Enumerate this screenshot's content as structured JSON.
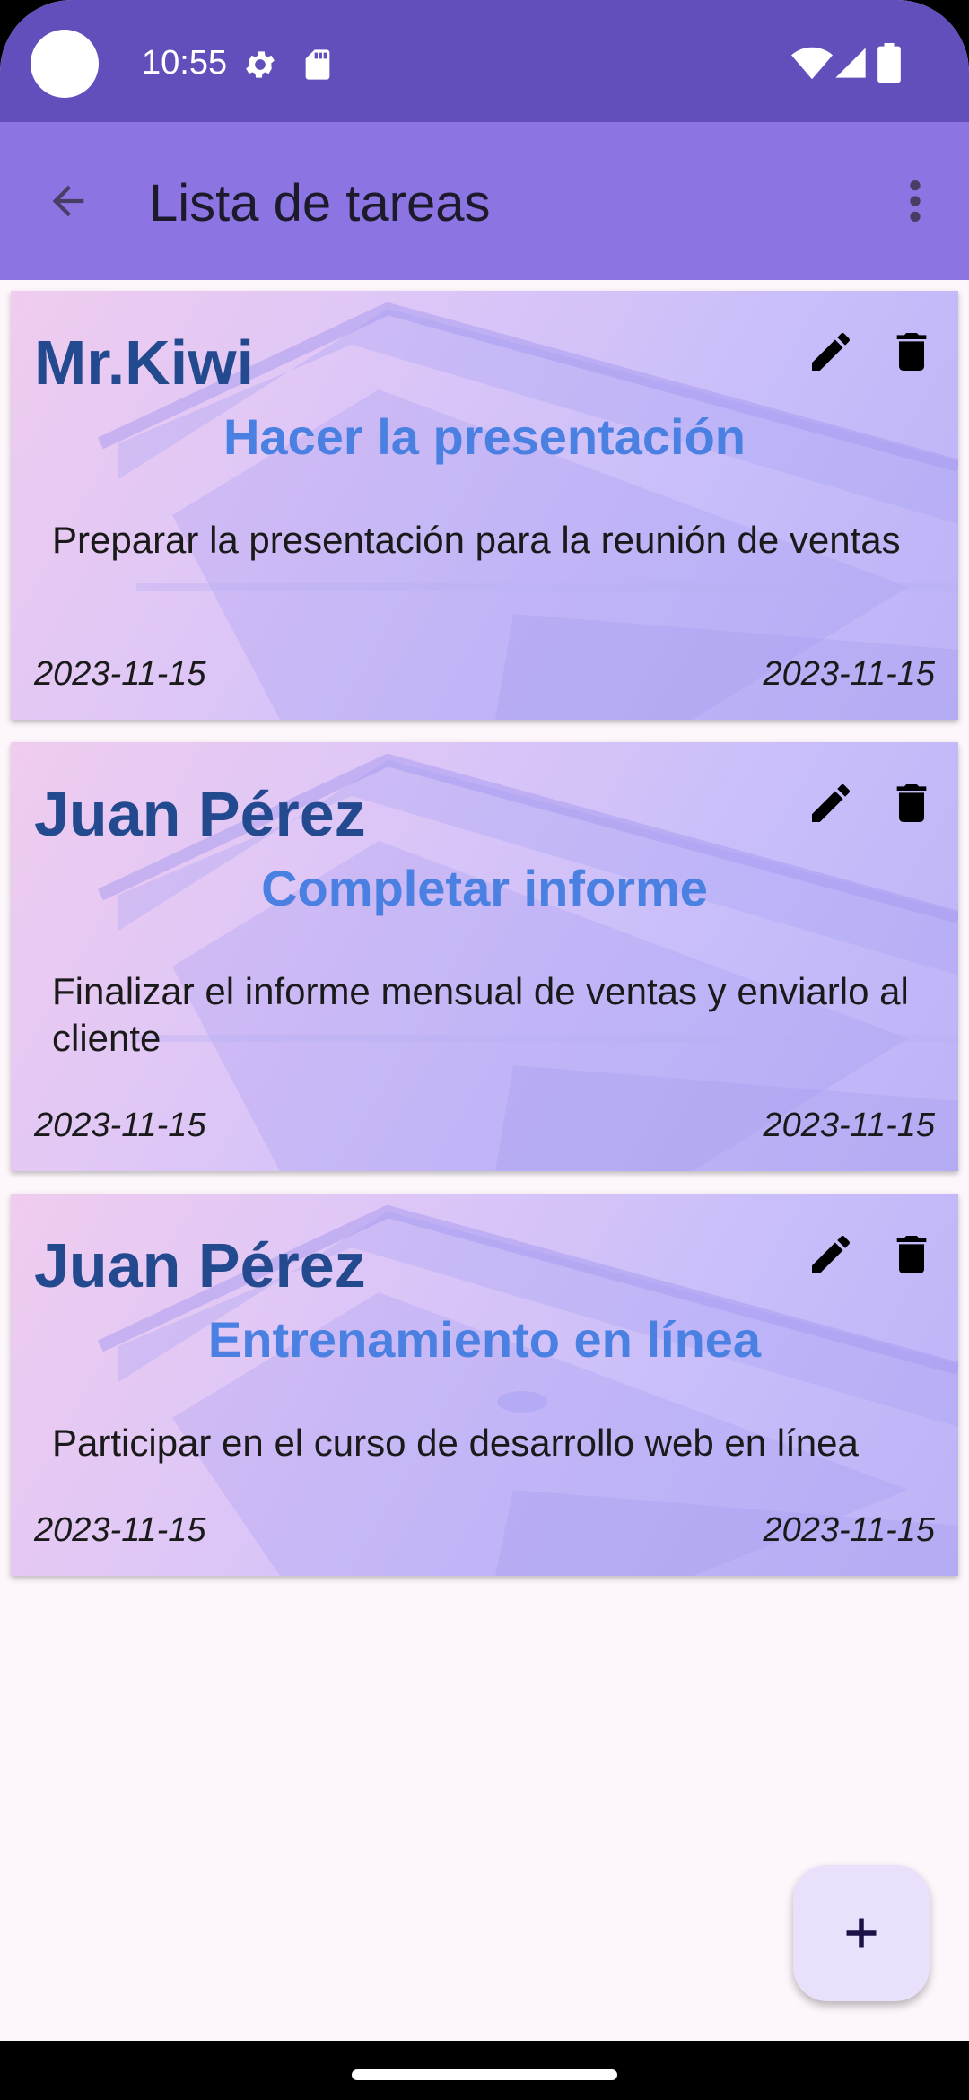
{
  "status_bar": {
    "time": "10:55",
    "icons": [
      "settings-gear-icon",
      "sd-card-icon",
      "wifi-icon",
      "signal-icon",
      "battery-icon"
    ],
    "background": "#634fbb"
  },
  "app_bar": {
    "title": "Lista de tareas",
    "back_icon": "arrow-back-icon",
    "menu_icon": "more-vert-icon",
    "background": "#8c74e3"
  },
  "tasks": [
    {
      "owner": "Mr.Kiwi",
      "title": "Hacer la presentación",
      "description": "Preparar la presentación para la reunión de ventas",
      "start_date": "2023-11-15",
      "end_date": "2023-11-15"
    },
    {
      "owner": "Juan Pérez",
      "title": "Completar informe",
      "description": "Finalizar el informe mensual de ventas y enviarlo al cliente",
      "start_date": "2023-11-15",
      "end_date": "2023-11-15"
    },
    {
      "owner": "Juan Pérez",
      "title": "Entrenamiento en línea",
      "description": "Participar en el curso de desarrollo web en línea",
      "start_date": "2023-11-15",
      "end_date": "2023-11-15"
    }
  ],
  "card_actions": {
    "edit_icon": "pencil-edit-icon",
    "delete_icon": "trash-delete-icon"
  },
  "fab": {
    "icon": "plus-icon",
    "background": "#e9e0fb"
  },
  "colors": {
    "owner_text": "#234a8e",
    "title_text": "#4a80e1",
    "screen_background": "#fdf7fb"
  }
}
